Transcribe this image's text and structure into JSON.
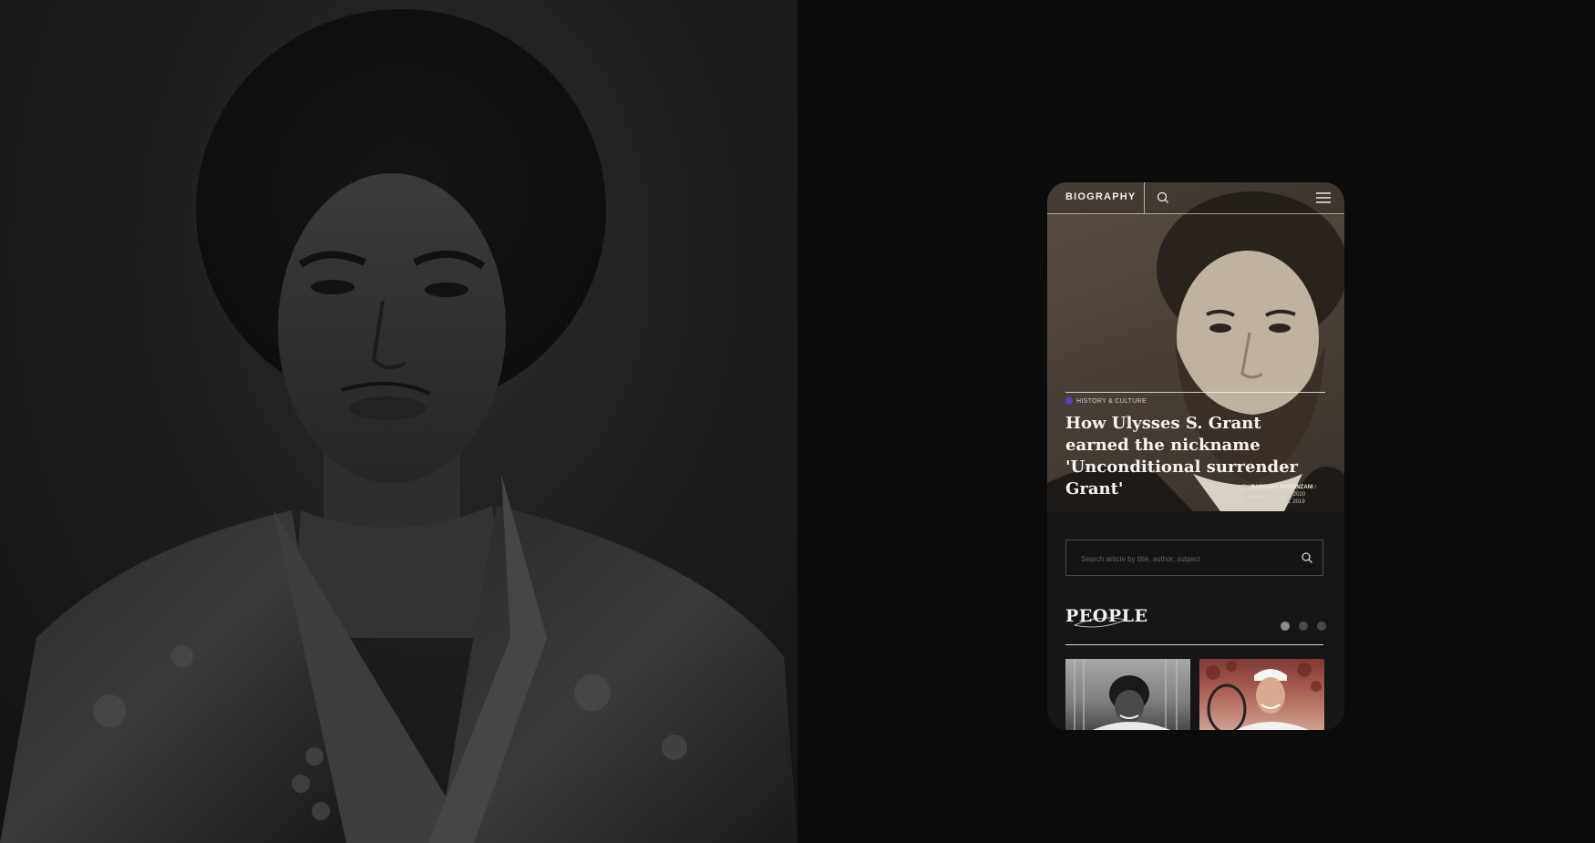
{
  "app": {
    "brand": "BIOGRAPHY"
  },
  "icons": {
    "search": "search-icon",
    "menu": "hamburger-menu-icon",
    "category_dot": "category-dot-icon"
  },
  "colors": {
    "page_background": "#0b0b0b",
    "phone_background": "#161616",
    "category_accent": "#5a3ec8",
    "headline_text": "#f7f5f1",
    "active_dot": "#8c8c8c",
    "inactive_dot": "#4a4a4a"
  },
  "featured_article": {
    "category": "HISTORY & CULTURE",
    "headline": "How Ulysses S. Grant earned the nickname 'Unconditional surrender Grant'",
    "byline": {
      "prefix": "BY",
      "author": "BARBARA MARANZANI",
      "separator": "/",
      "updated": "UPDATED: MAY 14, 2020",
      "original": "ORIGINAL: JUN 16, 2019"
    }
  },
  "search": {
    "placeholder": "Search article by title, author, subject"
  },
  "people_section": {
    "title": "PEOPLE",
    "pagination": {
      "total": 3,
      "active_index": 0
    }
  }
}
